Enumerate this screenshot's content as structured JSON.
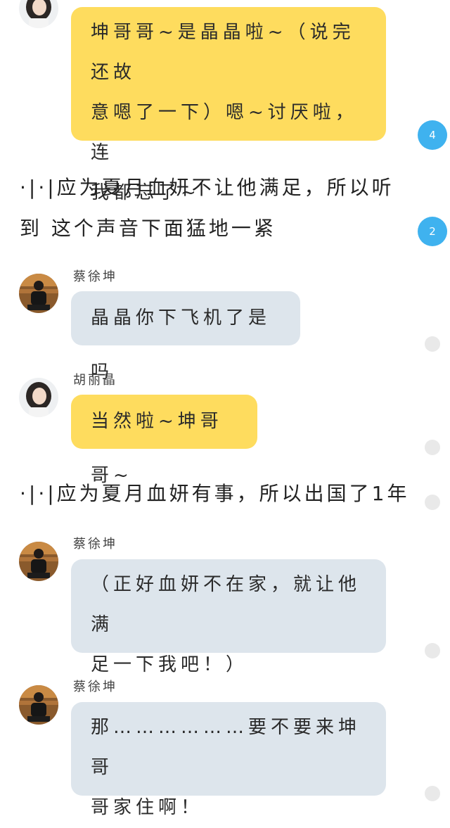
{
  "messages": [
    {
      "speaker": "胡丽晶",
      "text": "坤哥哥~是晶晶啦~（说完还故\n意嗯了一下）嗯~讨厌啦，连\n我都忘了~"
    },
    {
      "narration": "·|·|应为夏月血妍不让他满足，所以听到\n这个声音下面猛地一紧"
    },
    {
      "speaker": "蔡徐坤",
      "text": "晶晶你下飞机了是吗"
    },
    {
      "speaker": "胡丽晶",
      "text": "当然啦~坤哥哥~"
    },
    {
      "narration": "·|·|应为夏月血妍有事，所以出国了1年"
    },
    {
      "speaker": "蔡徐坤",
      "text": "（正好血妍不在家，就让他满\n足一下我吧！）"
    },
    {
      "speaker": "蔡徐坤",
      "text": "那………………要不要来坤哥\n哥家住啊！"
    }
  ],
  "comment_badges": [
    "4",
    "2"
  ],
  "colors": {
    "yellow_bubble": "#fedc5e",
    "grey_bubble": "#dde5ec",
    "badge": "#3fb2ef",
    "dot": "#e9e9e9"
  }
}
